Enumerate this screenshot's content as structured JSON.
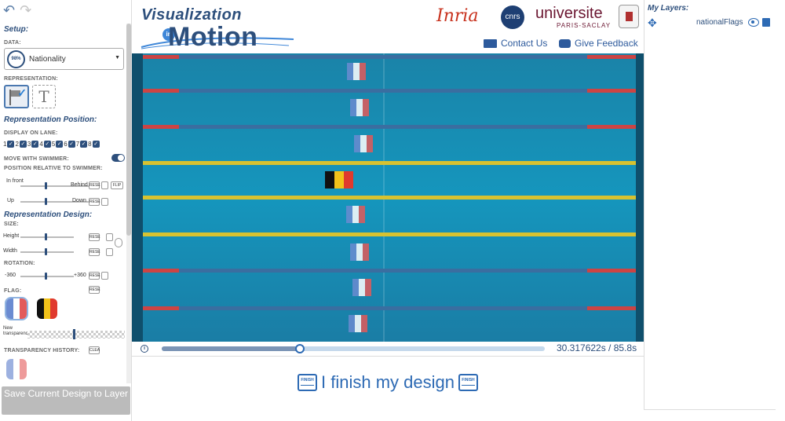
{
  "left_panel": {
    "setup_title": "Setup:",
    "data_label": "DATA:",
    "data_pct": "98%",
    "data_value": "Nationality",
    "representation_label": "REPRESENTATION:",
    "position_title": "Representation Position:",
    "display_on_lane_label": "DISPLAY ON LANE:",
    "lanes": [
      "1",
      "2",
      "3",
      "4",
      "5",
      "6",
      "7",
      "8"
    ],
    "move_with_swimmer_label": "MOVE WITH SWIMMER:",
    "move_with_swimmer_on": true,
    "position_relative_label": "POSITION RELATIVE TO SWIMMER:",
    "in_front_label": "In front",
    "behind_label": "Behind",
    "up_label": "Up",
    "down_label": "Down",
    "reset_label": "RESE",
    "flip_label": "FLIP",
    "design_title": "Representation Design:",
    "size_label": "SIZE:",
    "height_label": "Height",
    "width_label": "Width",
    "rotation_label": "ROTATION:",
    "rotation_min": "-360",
    "rotation_max": "+360",
    "flag_label": "FLAG:",
    "new_transparency_label": "New transparency",
    "transparency_history_label": "TRANSPARENCY HISTORY:",
    "clear_label": "CLEA",
    "save_button": "Save Current Design to Layer"
  },
  "header": {
    "logo_line1": "Visualization",
    "logo_in": "in",
    "logo_line2": "Motion",
    "inria": "Inria",
    "cnrs": "cnrs",
    "universite": "universite",
    "paris_saclay": "PARIS-SACLAY",
    "contact": "Contact Us",
    "feedback": "Give Feedback"
  },
  "player": {
    "timecode": "30.317622s / 85.8s",
    "progress_fraction": 0.36
  },
  "finish_text": "I finish my design",
  "finish_icon_label": "FINISH",
  "right_panel": {
    "title": "My Layers:",
    "layers": [
      "nationalFlags"
    ]
  },
  "colors": {
    "primary": "#2d4f7c",
    "accent": "#2d6ab4",
    "water": "#1596bd"
  }
}
